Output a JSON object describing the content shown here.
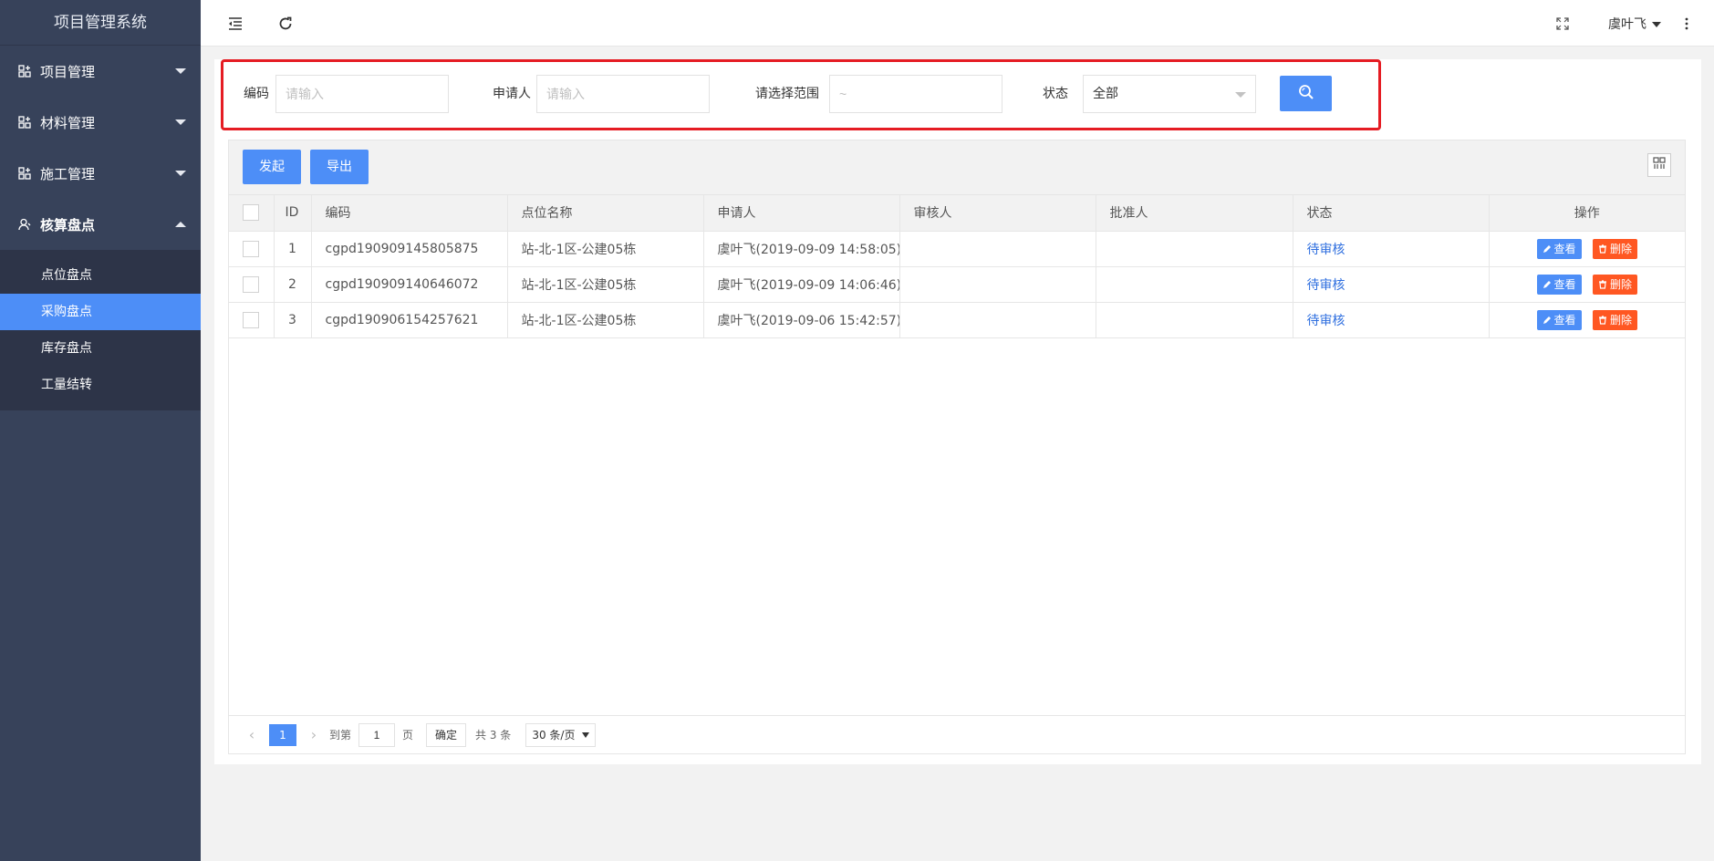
{
  "app": {
    "title": "项目管理系统"
  },
  "sidebar": {
    "items": [
      {
        "label": "项目管理",
        "icon": "grid-plus-icon",
        "expanded": false
      },
      {
        "label": "材料管理",
        "icon": "grid-plus-icon",
        "expanded": false
      },
      {
        "label": "施工管理",
        "icon": "grid-plus-icon",
        "expanded": false
      },
      {
        "label": "核算盘点",
        "icon": "user-icon",
        "expanded": true
      }
    ],
    "sub_items": [
      {
        "label": "点位盘点",
        "active": false
      },
      {
        "label": "采购盘点",
        "active": true
      },
      {
        "label": "库存盘点",
        "active": false
      },
      {
        "label": "工量结转",
        "active": false
      }
    ]
  },
  "header": {
    "user_name": "虞叶飞",
    "icons": [
      "menu-indent-icon",
      "refresh-icon",
      "fullscreen-icon",
      "more-vertical-icon"
    ]
  },
  "search": {
    "code_label": "编码",
    "code_placeholder": "请输入",
    "applicant_label": "申请人",
    "applicant_placeholder": "请输入",
    "range_label": "请选择范围",
    "range_placeholder": "~",
    "status_label": "状态",
    "status_value": "全部"
  },
  "toolbar": {
    "start_label": "发起",
    "export_label": "导出"
  },
  "table": {
    "headers": [
      "ID",
      "编码",
      "点位名称",
      "申请人",
      "审核人",
      "批准人",
      "状态",
      "操作"
    ],
    "rows": [
      {
        "id": "1",
        "code": "cgpd190909145805875",
        "site": "站-北-1区-公建05栋",
        "applicant": "虞叶飞(2019-09-09 14:58:05)",
        "reviewer": "",
        "approver": "",
        "status": "待审核"
      },
      {
        "id": "2",
        "code": "cgpd190909140646072",
        "site": "站-北-1区-公建05栋",
        "applicant": "虞叶飞(2019-09-09 14:06:46)",
        "reviewer": "",
        "approver": "",
        "status": "待审核"
      },
      {
        "id": "3",
        "code": "cgpd190906154257621",
        "site": "站-北-1区-公建05栋",
        "applicant": "虞叶飞(2019-09-06 15:42:57)",
        "reviewer": "",
        "approver": "",
        "status": "待审核"
      }
    ],
    "view_label": "查看",
    "delete_label": "删除"
  },
  "pager": {
    "current_page": "1",
    "goto_label": "到第",
    "goto_value": "1",
    "page_unit": "页",
    "confirm_label": "确定",
    "total_text": "共 3 条",
    "page_size": "30 条/页"
  },
  "colors": {
    "sidebar": "#37425a",
    "submenu": "#2d3448",
    "accent": "#4d8ef7",
    "danger": "#ff5722",
    "highlight": "#e51c23"
  }
}
